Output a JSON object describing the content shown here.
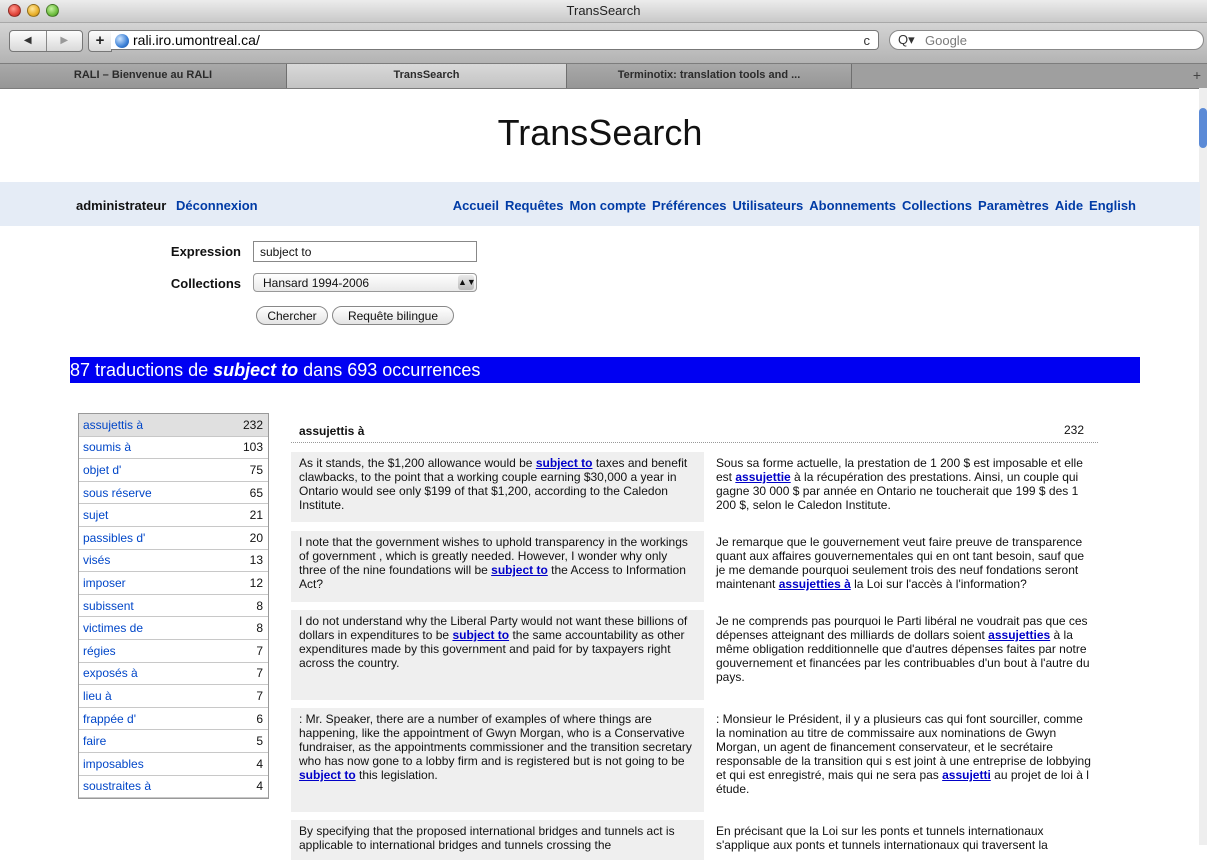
{
  "window": {
    "title": "TransSearch"
  },
  "browser": {
    "url": "rali.iro.umontreal.ca/",
    "search_placeholder": "Google",
    "reload_symbol": "c",
    "tabs": [
      {
        "label": "RALI – Bienvenue au RALI"
      },
      {
        "label": "TransSearch"
      },
      {
        "label": "Terminotix: translation tools and ..."
      }
    ]
  },
  "page": {
    "title": "TransSearch",
    "nav": {
      "user": "administrateur",
      "logout": "Déconnexion",
      "menu": [
        "Accueil",
        "Requêtes",
        "Mon compte",
        "Préférences",
        "Utilisateurs",
        "Abonnements",
        "Collections",
        "Paramètres",
        "Aide",
        "English"
      ]
    },
    "form": {
      "expression_label": "Expression",
      "expression_value": "subject to",
      "collections_label": "Collections",
      "collections_value": "Hansard 1994-2006",
      "search_button": "Chercher",
      "bilingual_button": "Requête bilingue"
    },
    "result_summary": {
      "count": "87",
      "text1": "traductions de",
      "query": "subject to",
      "text2": "dans",
      "occurrences": "693",
      "text3": "occurrences"
    },
    "translations": [
      {
        "term": "assujettis à",
        "count": "232"
      },
      {
        "term": "soumis à",
        "count": "103"
      },
      {
        "term": "objet d'",
        "count": "75"
      },
      {
        "term": "sous réserve",
        "count": "65"
      },
      {
        "term": "sujet",
        "count": "21"
      },
      {
        "term": "passibles d'",
        "count": "20"
      },
      {
        "term": "visés",
        "count": "13"
      },
      {
        "term": "imposer",
        "count": "12"
      },
      {
        "term": "subissent",
        "count": "8"
      },
      {
        "term": "victimes de",
        "count": "8"
      },
      {
        "term": "régies",
        "count": "7"
      },
      {
        "term": "exposés à",
        "count": "7"
      },
      {
        "term": "lieu à",
        "count": "7"
      },
      {
        "term": "frappée d'",
        "count": "6"
      },
      {
        "term": "faire",
        "count": "5"
      },
      {
        "term": "imposables",
        "count": "4"
      },
      {
        "term": "soustraites à",
        "count": "4"
      }
    ],
    "detail": {
      "term": "assujettis à",
      "count": "232",
      "pairs": [
        {
          "en_before": "As it stands, the $1,200 allowance would be ",
          "en_hl": "subject to",
          "en_after": " taxes and benefit clawbacks, to the point that a working couple earning $30,000 a year in Ontario would see only $199 of that $1,200, according to the Caledon Institute.",
          "fr_before": "Sous sa forme actuelle, la prestation de 1 200 $ est imposable et elle est ",
          "fr_hl": "assujettie",
          "fr_after": " à la récupération des prestations. Ainsi, un couple qui gagne 30 000 $ par année en Ontario ne toucherait que 199 $ des 1 200 $, selon le Caledon Institute."
        },
        {
          "en_before": "I note that the government wishes to uphold transparency in the workings of government , which is greatly needed. However, I wonder why only three of the nine foundations will be ",
          "en_hl": "subject to",
          "en_after": " the Access to Information Act?",
          "fr_before": "Je remarque que le gouvernement veut faire preuve de transparence quant aux affaires gouvernementales qui en ont tant besoin, sauf que je me demande pourquoi seulement trois des neuf fondations seront maintenant ",
          "fr_hl": "assujetties à",
          "fr_after": " la Loi sur l'accès à l'information?"
        },
        {
          "en_before": "I do not understand why the Liberal Party would not want these billions of dollars in expenditures to be ",
          "en_hl": "subject to",
          "en_after": " the same accountability as other expenditures made by this government and paid for by taxpayers right across the country.",
          "fr_before": "Je ne comprends pas pourquoi le Parti libéral ne voudrait pas que ces dépenses atteignant des milliards de dollars soient ",
          "fr_hl": "assujetties",
          "fr_after": " à la même obligation redditionnelle que d'autres dépenses faites par notre gouvernement et financées par les contribuables d'un bout à l'autre du pays."
        },
        {
          "en_before": ": Mr. Speaker, there are a number of examples of where things are happening, like the appointment of Gwyn Morgan, who is a Conservative fundraiser, as the appointments commissioner and the transition secretary who has now gone to a lobby firm and is registered but is not going to be ",
          "en_hl": "subject to",
          "en_after": " this legislation.",
          "fr_before": ": Monsieur le Président, il y a plusieurs cas qui font sourciller, comme la nomination au titre de commissaire aux nominations de Gwyn Morgan, un agent de financement conservateur, et le secrétaire responsable de la transition qui s est joint à une entreprise de lobbying et qui est enregistré, mais qui ne sera pas ",
          "fr_hl": "assujetti",
          "fr_after": " au projet de loi à l étude."
        },
        {
          "en_before": "By specifying that the proposed international bridges and tunnels act is applicable to international bridges and tunnels crossing the",
          "en_hl": "",
          "en_after": "",
          "fr_before": "En précisant que la Loi sur les ponts et tunnels internationaux s'applique aux ponts et tunnels internationaux qui traversent la",
          "fr_hl": "",
          "fr_after": ""
        }
      ]
    }
  }
}
